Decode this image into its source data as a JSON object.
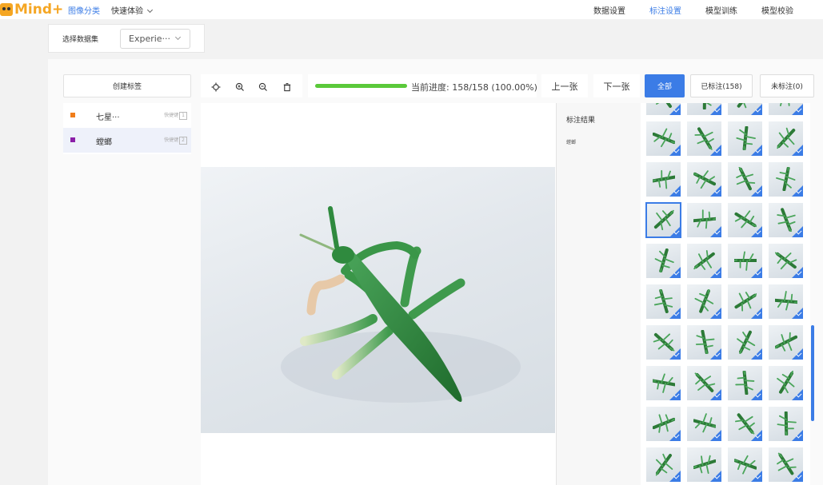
{
  "app": {
    "logo": "Mind+"
  },
  "topnav": {
    "left": {
      "image_classify": "图像分类",
      "quick": "快速体验"
    },
    "right": [
      "数据设置",
      "标注设置",
      "模型训练",
      "模型校验"
    ],
    "active_right_index": 1
  },
  "dataset": {
    "label": "选择数据集",
    "value": "Experie···"
  },
  "labels_panel": {
    "create_button": "创建标签",
    "items": [
      {
        "name": "七星···",
        "shortcut_label": "快捷键",
        "shortcut_key": "1",
        "color": "#f07d1a"
      },
      {
        "name": "螳螂",
        "shortcut_label": "快捷键",
        "shortcut_key": "2",
        "color": "#8b1fa8"
      }
    ],
    "selected_index": 1
  },
  "toolbar": {
    "icons": [
      "reset-icon",
      "zoom-in-icon",
      "zoom-out-icon",
      "delete-icon"
    ]
  },
  "progress": {
    "text": "当前进度: 158/158 (100.00%)",
    "fraction": 1.0,
    "color": "#5ac93a"
  },
  "nav": {
    "prev": "上一张",
    "next": "下一张"
  },
  "filters": {
    "all": "全部",
    "labeled": "已标注(158)",
    "unlabeled": "未标注(0)"
  },
  "result": {
    "title": "标注结果",
    "value": "螳螂"
  },
  "accent": "#3b7ce6"
}
